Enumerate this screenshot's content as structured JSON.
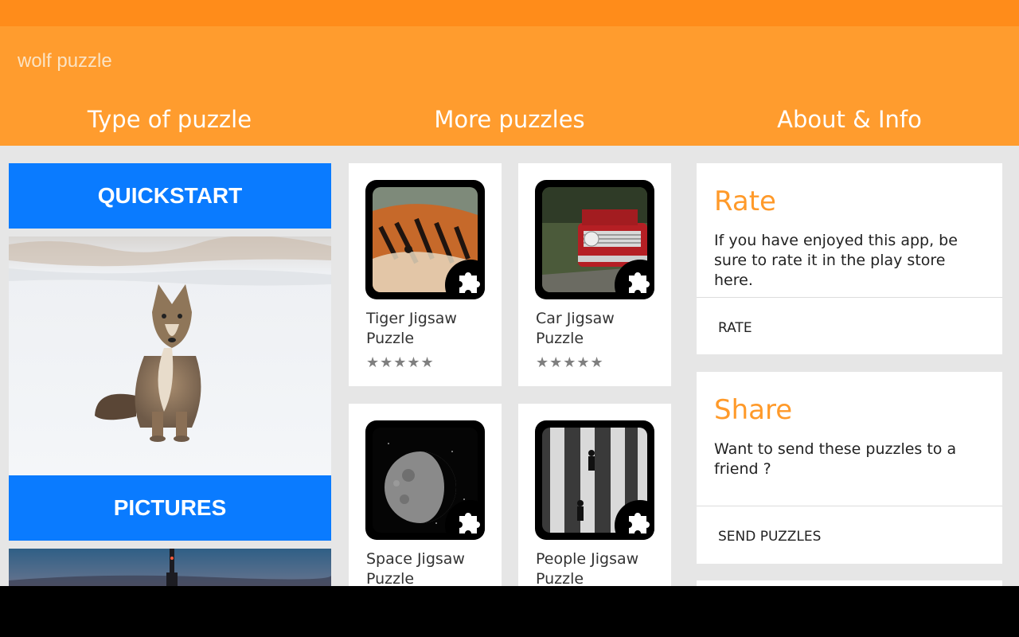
{
  "app": {
    "title": "wolf puzzle"
  },
  "tabs": [
    {
      "label": "Type of puzzle"
    },
    {
      "label": "More puzzles"
    },
    {
      "label": "About & Info"
    }
  ],
  "left": {
    "quickstart_label": "QUICKSTART",
    "pictures_label": "PICTURES"
  },
  "puzzles": [
    {
      "title": "Tiger Jigsaw Puzzle",
      "stars": "★★★★★"
    },
    {
      "title": "Car Jigsaw Puzzle",
      "stars": "★★★★★"
    },
    {
      "title": "Space Jigsaw Puzzle"
    },
    {
      "title": "People Jigsaw Puzzle"
    }
  ],
  "about": {
    "rate": {
      "title": "Rate",
      "text": "If you have enjoyed this app, be sure to rate it in the play store here.",
      "action": "RATE"
    },
    "share": {
      "title": "Share",
      "text": "Want to send these puzzles to a friend ?",
      "action": "SEND PUZZLES"
    }
  },
  "colors": {
    "accent": "#ff9c2e",
    "statusbar": "#ff8c1a",
    "button_blue": "#0a7bff",
    "title_orange": "#ff9a2a"
  }
}
